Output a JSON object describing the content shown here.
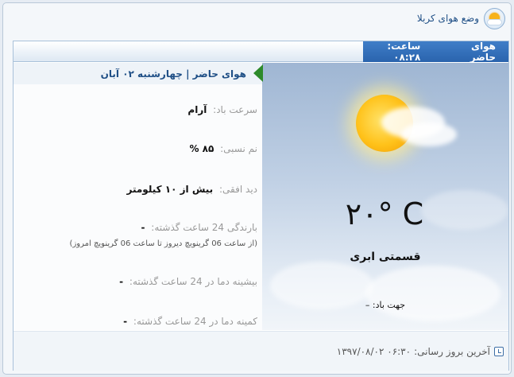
{
  "header": {
    "title": "وضع هوای کربلا",
    "icon": "weather-icon"
  },
  "tabs": {
    "current_label": "هوای حاضر",
    "time_label": "ساعت: ۰۸:۲۸"
  },
  "details": {
    "date_title": "هوای حاضر | چهارشنبه ۰۲ آبان",
    "wind_speed_label": "سرعت باد:",
    "wind_speed_value": "آرام",
    "humidity_label": "نم نسبی:",
    "humidity_value": "۸۵ %",
    "visibility_label": "دید افقی:",
    "visibility_value": "بیش از ۱۰ کیلومتر",
    "precip_label": "بارندگی 24 ساعت گذشته:",
    "precip_value": "-",
    "precip_note": "(از ساعت 06 گرینویچ دیروز تا ساعت 06 گرینویچ امروز)",
    "max_temp_label": "بیشینه دما در 24 ساعت گذشته:",
    "max_temp_value": "-",
    "min_temp_label": "کمینه دما در 24 ساعت گذشته:",
    "min_temp_value": "-"
  },
  "weather": {
    "temperature": "۲۰° C",
    "condition": "قسمتی ابری",
    "wind_direction": "جهت باد: –"
  },
  "footer": {
    "last_update_label": "آخرین بروز رسانی:",
    "last_update_value": "۱۳۹۷/۰۸/۰۲ ۰۶:۳۰"
  },
  "colors": {
    "accent": "#2a64ad",
    "title": "#1f4f86",
    "marker": "#2d8a2a"
  }
}
